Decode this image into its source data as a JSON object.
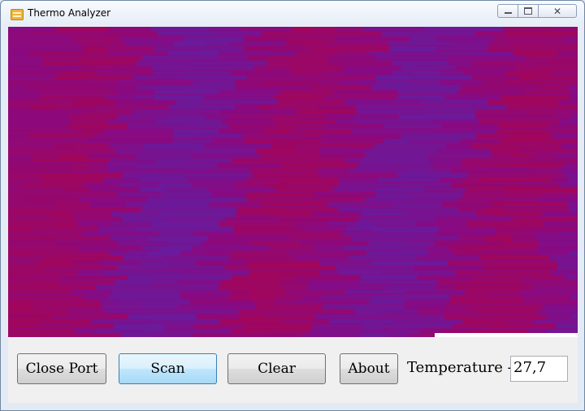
{
  "window": {
    "title": "Thermo Analyzer",
    "icon": "app-folder-icon",
    "controls": {
      "minimize": "minimize-icon",
      "maximize": "maximize-icon",
      "close": "✕"
    }
  },
  "thermal_view": {
    "colors": {
      "cool": "#6a1a9a",
      "mid": "#880a82",
      "warm": "#a0065c"
    }
  },
  "progress": {
    "value": 0.25,
    "color": "#ffffff"
  },
  "controls": {
    "close_port_label": "Close Port",
    "scan_label": "Scan",
    "clear_label": "Clear",
    "about_label": "About",
    "temperature_label": "Temperature -",
    "temperature_value": "27,7"
  }
}
